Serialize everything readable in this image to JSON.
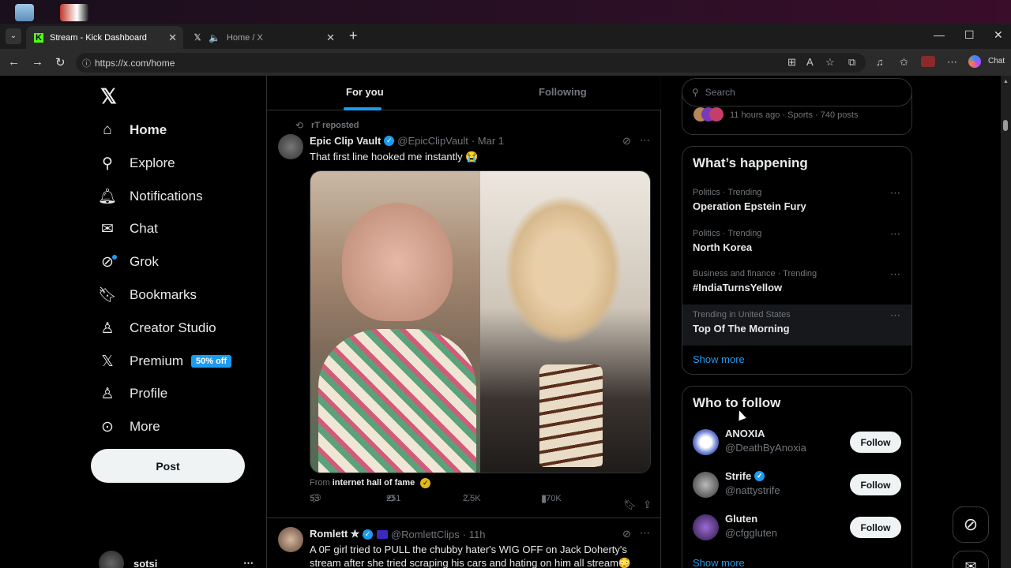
{
  "tabs": [
    {
      "title": "Stream - Kick Dashboard",
      "favicon": "kick-icon",
      "color": "#53fc18"
    },
    {
      "title": "Home / X",
      "favicon": "x-icon"
    }
  ],
  "address": {
    "url": "https://x.com/home"
  },
  "browser": {
    "chat_label": "Chat"
  },
  "sidebar": {
    "items": [
      {
        "label": "Home",
        "icon": "home-icon"
      },
      {
        "label": "Explore",
        "icon": "search-icon"
      },
      {
        "label": "Notifications",
        "icon": "bell-icon"
      },
      {
        "label": "Chat",
        "icon": "mail-icon"
      },
      {
        "label": "Grok",
        "icon": "grok-icon"
      },
      {
        "label": "Bookmarks",
        "icon": "bookmark-icon"
      },
      {
        "label": "Creator Studio",
        "icon": "creator-icon"
      },
      {
        "label": "Premium",
        "icon": "x-premium-icon",
        "badge": "50% off"
      },
      {
        "label": "Profile",
        "icon": "person-icon"
      },
      {
        "label": "More",
        "icon": "more-circle-icon"
      }
    ],
    "post_label": "Post",
    "user": {
      "name": "sotsi"
    }
  },
  "timeline": {
    "tabs": [
      "For you",
      "Following"
    ],
    "tweets": [
      {
        "repost_label": "rT reposted",
        "name": "Epic Clip Vault",
        "handle": "@EpicClipVault",
        "time": "· Mar 1",
        "text": "That first line hooked me instantly 😭",
        "from_prefix": "From",
        "from_name": "internet hall of fame",
        "replies": "53",
        "reposts": "251",
        "likes": "2.5K",
        "views": "170K"
      },
      {
        "name": "Romlett ✯",
        "handle": "@RomlettClips",
        "time": "· 11h",
        "text": "A 0F girl tried to PULL the chubby hater's WIG OFF on Jack Doherty's stream after she tried scraping his cars and hating on him all stream😳"
      }
    ]
  },
  "right": {
    "search_placeholder": "Search",
    "sports_line": "11 hours ago · Sports · 740 posts",
    "whats_happening": "What’s happening",
    "trends": [
      {
        "category": "Politics · Trending",
        "title": "Operation Epstein Fury"
      },
      {
        "category": "Politics · Trending",
        "title": "North Korea"
      },
      {
        "category": "Business and finance · Trending",
        "title": "#IndiaTurnsYellow"
      },
      {
        "category": "Trending in United States",
        "title": "Top Of The Morning"
      }
    ],
    "show_more": "Show more",
    "who_to_follow": "Who to follow",
    "follows": [
      {
        "name": "ANOXIA",
        "handle": "@DeathByAnoxia",
        "button": "Follow"
      },
      {
        "name": "Strife",
        "handle": "@nattystrife",
        "button": "Follow"
      },
      {
        "name": "Gluten",
        "handle": "@cfggluten",
        "button": "Follow"
      }
    ],
    "show_more_2": "Show more"
  }
}
